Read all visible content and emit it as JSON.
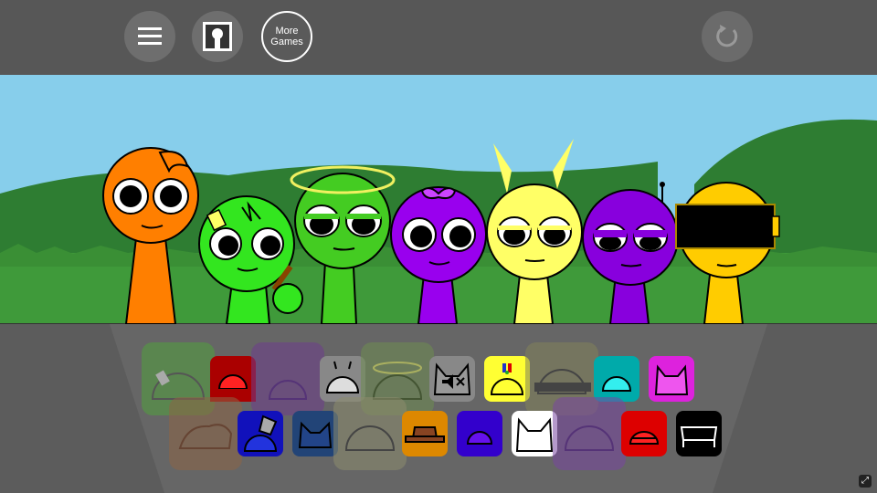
{
  "toolbar": {
    "menu_icon": "hamburger-menu-icon",
    "gallery_icon": "keyhole-portrait-icon",
    "more_games_line1": "More",
    "more_games_line2": "Games",
    "reset_icon": "circular-arrow-reset-icon"
  },
  "characters": [
    {
      "name": "orange",
      "color": "#ff7f00"
    },
    {
      "name": "green-lime",
      "color": "#33e61f"
    },
    {
      "name": "green-halo",
      "color": "#44cc22"
    },
    {
      "name": "purple-bow",
      "color": "#9900ee"
    },
    {
      "name": "yellow-horns",
      "color": "#ffff66"
    },
    {
      "name": "violet",
      "color": "#8800dd"
    },
    {
      "name": "yellow-glasses",
      "color": "#ffcc00"
    }
  ],
  "palette_colors": {
    "sky": "#87ceeb",
    "grass": "#3f9a3a",
    "hill": "#2e7d32",
    "accent_red": "#dd0000",
    "accent_blue": "#0000cc"
  },
  "sound_icons_row1": [
    {
      "name": "green-ghost-icon",
      "state": "used"
    },
    {
      "name": "red-dome-icon",
      "state": "available"
    },
    {
      "name": "purple-ghost-icon",
      "state": "used"
    },
    {
      "name": "antenna-dome-icon",
      "state": "available"
    },
    {
      "name": "halo-ghost-icon",
      "state": "used"
    },
    {
      "name": "muted-cat-icon",
      "state": "muted"
    },
    {
      "name": "propeller-cap-icon",
      "state": "available"
    },
    {
      "name": "glasses-ghost-icon",
      "state": "used"
    },
    {
      "name": "cyan-dome-icon",
      "state": "available"
    },
    {
      "name": "pink-horns-icon",
      "state": "available"
    }
  ],
  "sound_icons_row2": [
    {
      "name": "orange-hair-ghost-icon",
      "state": "used"
    },
    {
      "name": "blue-bucket-icon",
      "state": "available"
    },
    {
      "name": "navy-cat-ears-icon",
      "state": "available"
    },
    {
      "name": "olive-ghost-icon",
      "state": "used"
    },
    {
      "name": "brown-hat-icon",
      "state": "available"
    },
    {
      "name": "indigo-dome-icon",
      "state": "available"
    },
    {
      "name": "white-cat-icon",
      "state": "available"
    },
    {
      "name": "violet-ghost-icon",
      "state": "used"
    },
    {
      "name": "red-cap-icon",
      "state": "available"
    },
    {
      "name": "black-bench-icon",
      "state": "available"
    }
  ],
  "corner_icon": "expand-icon"
}
